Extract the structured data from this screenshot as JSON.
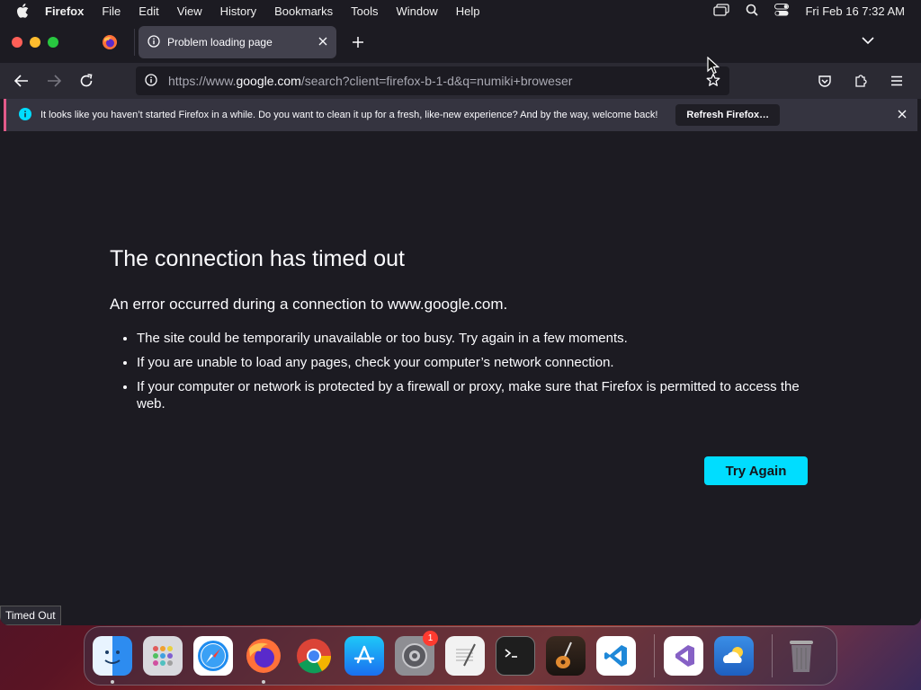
{
  "menubar": {
    "app_name": "Firefox",
    "items": [
      "File",
      "Edit",
      "View",
      "History",
      "Bookmarks",
      "Tools",
      "Window",
      "Help"
    ],
    "clock": "Fri Feb 16  7:32 AM"
  },
  "tab": {
    "title": "Problem loading page"
  },
  "urlbar": {
    "url_prefix": "https://www.",
    "url_domain": "google.com",
    "url_rest": "/search?client=firefox-b-1-d&q=numiki+broweser"
  },
  "notice": {
    "message": "It looks like you haven’t started Firefox in a while. Do you want to clean it up for a fresh, like-new experience? And by the way, welcome back!",
    "button": "Refresh Firefox…"
  },
  "error": {
    "title": "The connection has timed out",
    "subtitle": "An error occurred during a connection to www.google.com.",
    "bullets": [
      "The site could be temporarily unavailable or too busy. Try again in a few moments.",
      "If you are unable to load any pages, check your computer’s network connection.",
      "If your computer or network is protected by a firewall or proxy, make sure that Firefox is permitted to access the web."
    ],
    "button": "Try Again"
  },
  "status_text": "Timed Out",
  "dock": {
    "settings_badge": "1"
  },
  "colors": {
    "accent": "#00ddff",
    "notice_border": "#e35b8a",
    "background": "#1c1b22"
  }
}
